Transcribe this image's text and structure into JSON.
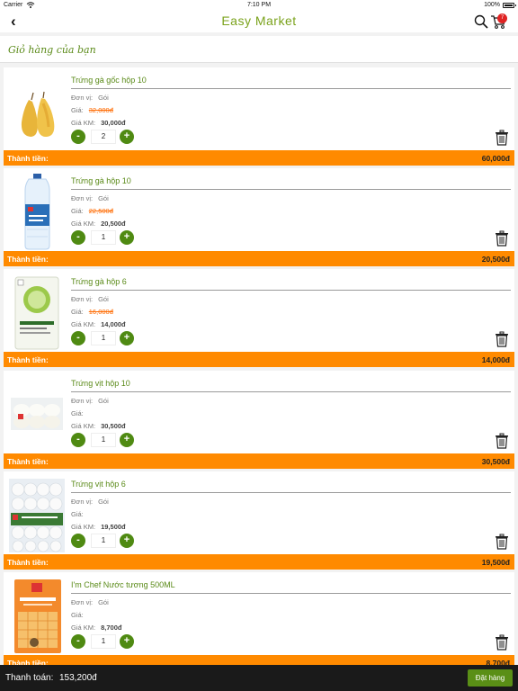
{
  "status_bar": {
    "carrier": "Carrier",
    "time": "7:10 PM",
    "battery": "100%"
  },
  "header": {
    "title": "Easy Market",
    "cart_count": "7"
  },
  "section": {
    "title": "Giỏ hàng của bạn"
  },
  "labels": {
    "unit": "Đơn vị:",
    "price": "Giá:",
    "sale_price": "Giá KM:",
    "line_total": "Thành tiền:"
  },
  "items": [
    {
      "name": "Trứng gà gốc hộp 10",
      "unit": "Gói",
      "price": "32,000đ",
      "sale_price": "30,000đ",
      "quantity": "2",
      "total": "60,000đ"
    },
    {
      "name": "Trứng gà hộp 10",
      "unit": "Gói",
      "price": "22,500đ",
      "sale_price": "20,500đ",
      "quantity": "1",
      "total": "20,500đ"
    },
    {
      "name": "Trứng gà hộp 6",
      "unit": "Gói",
      "price": "16,000đ",
      "sale_price": "14,000đ",
      "quantity": "1",
      "total": "14,000đ"
    },
    {
      "name": "Trứng vịt hộp 10",
      "unit": "Gói",
      "price": "",
      "sale_price": "30,500đ",
      "quantity": "1",
      "total": "30,500đ"
    },
    {
      "name": "Trứng vịt hộp 6",
      "unit": "Gói",
      "price": "",
      "sale_price": "19,500đ",
      "quantity": "1",
      "total": "19,500đ"
    },
    {
      "name": "I'm Chef Nước tương 500ML",
      "unit": "Gói",
      "price": "",
      "sale_price": "8,700đ",
      "quantity": "1",
      "total": "8,700đ"
    }
  ],
  "footer": {
    "pay_label": "Thanh toán:",
    "pay_total": "153,200đ",
    "order_button": "Đặt hàng"
  },
  "colors": {
    "brand_green": "#7aa21b",
    "button_green": "#4f8a12",
    "total_bar": "#ff8a00",
    "old_price": "#ff6a00",
    "badge": "#e02424",
    "footer": "#1a1a1a"
  },
  "icons": [
    "back-arrow-icon",
    "search-icon",
    "cart-icon",
    "minus-icon",
    "plus-icon",
    "trash-icon"
  ]
}
